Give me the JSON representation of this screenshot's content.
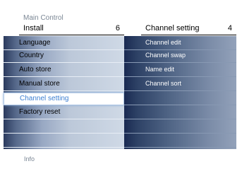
{
  "menu_title": "Main Control",
  "left_header": {
    "label": "Install",
    "number": "6"
  },
  "right_header": {
    "label": "Channel setting",
    "number": "4"
  },
  "left_items": [
    "Language",
    "Country",
    "Auto store",
    "Manual store",
    "Channel setting",
    "Factory reset",
    "",
    ""
  ],
  "selected_index": 4,
  "right_items": [
    "Channel edit",
    "Channel swap",
    "Name edit",
    "Channel sort",
    "",
    "",
    "",
    ""
  ],
  "info_label": "Info"
}
